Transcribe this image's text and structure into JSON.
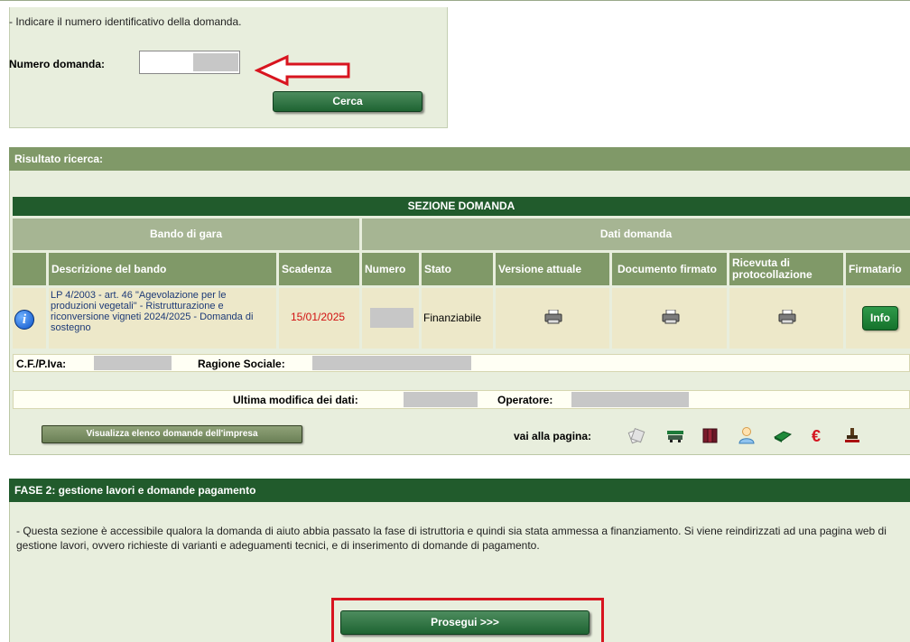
{
  "search": {
    "hint": "- Indicare il numero identificativo della domanda.",
    "numero_label": "Numero domanda:",
    "numero_value": "",
    "search_button": "Cerca"
  },
  "results": {
    "header": "Risultato ricerca:",
    "section_title": "SEZIONE DOMANDA",
    "group_bando": "Bando di gara",
    "group_dati": "Dati domanda",
    "columns": {
      "descrizione": "Descrizione del bando",
      "scadenza": "Scadenza",
      "numero": "Numero",
      "stato": "Stato",
      "versione": "Versione attuale",
      "documento": "Documento firmato",
      "ricevuta": "Ricevuta di protocollazione",
      "firmatario": "Firmatario"
    },
    "row": {
      "descrizione": "LP 4/2003 - art. 46 \"Agevolazione per le produzioni vegetali\" - Ristrutturazione e riconversione vigneti 2024/2025 - Domanda di sostegno",
      "scadenza": "15/01/2025",
      "stato": "Finanziabile",
      "info_button": "Info"
    },
    "cf_label": "C.F./P.Iva:",
    "ragione_label": "Ragione Sociale:",
    "ultima_label": "Ultima modifica dei dati:",
    "operatore_label": "Operatore:",
    "visualizza_button": "Visualizza elenco domande dell'impresa",
    "vai_label": "vai alla pagina:",
    "nav_icons": [
      "documents-icon",
      "truck-icon",
      "binders-icon",
      "user-icon",
      "book-icon",
      "euro-icon",
      "stamp-icon"
    ]
  },
  "fase2": {
    "header": "FASE 2: gestione lavori e domande pagamento",
    "description": "- Questa sezione è accessibile qualora la domanda di aiuto abbia passato la fase di istruttoria e quindi sia stata ammessa a finanziamento. Si viene reindirizzati ad una pagina web di gestione lavori, ovvero richieste di varianti e adeguamenti tecnici, e di inserimento di domande di pagamento.",
    "prosegui_button": "Prosegui >>>"
  },
  "colors": {
    "panel_bg": "#e8eedd",
    "dark_green": "#215b2c",
    "olive_header": "#809968",
    "row_bg": "#ede8c9",
    "deadline_red": "#d21010",
    "annotation_red": "#d8141f"
  }
}
